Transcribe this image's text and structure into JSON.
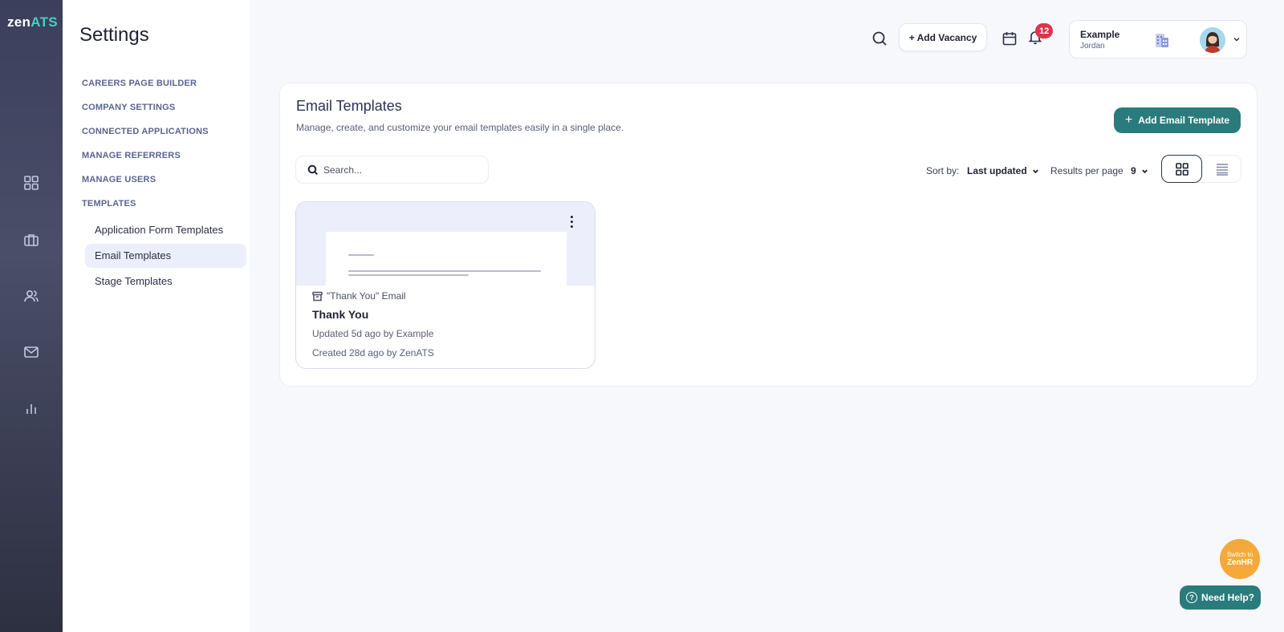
{
  "brand": {
    "logo_prefix": "zen",
    "logo_suffix": "ATS"
  },
  "rail": {
    "items": [
      {
        "icon": "dashboard-icon"
      },
      {
        "icon": "briefcase-icon"
      },
      {
        "icon": "users-icon"
      },
      {
        "icon": "mail-icon"
      },
      {
        "icon": "bar-chart-icon"
      }
    ]
  },
  "settings": {
    "title": "Settings",
    "sections": [
      {
        "label": "CAREERS PAGE BUILDER"
      },
      {
        "label": "COMPANY SETTINGS"
      },
      {
        "label": "CONNECTED APPLICATIONS"
      },
      {
        "label": "MANAGE REFERRERS"
      },
      {
        "label": "MANAGE USERS"
      },
      {
        "label": "TEMPLATES"
      }
    ],
    "template_links": [
      {
        "label": "Application Form Templates",
        "active": false
      },
      {
        "label": "Email Templates",
        "active": true
      },
      {
        "label": "Stage Templates",
        "active": false
      }
    ]
  },
  "topbar": {
    "add_vacancy_label": "+ Add Vacancy",
    "notification_count": "12",
    "account": {
      "company": "Example",
      "user": "Jordan"
    }
  },
  "main": {
    "title": "Email Templates",
    "subtitle": "Manage, create, and customize your email templates easily in a single place.",
    "add_button_label": "Add Email Template",
    "search_placeholder": "Search...",
    "sort_label": "Sort by:",
    "sort_value": "Last updated",
    "rpp_label": "Results per page",
    "rpp_value": "9",
    "view_mode": "grid"
  },
  "templates": [
    {
      "category": "\"Thank You\" Email",
      "name": "Thank You",
      "updated": "Updated 5d ago by Example",
      "created": "Created 28d ago by ZenATS"
    }
  ],
  "floating": {
    "switch_line1": "Switch to",
    "switch_line2": "ZenHR",
    "help_label": "Need Help?"
  },
  "colors": {
    "accent": "#2a7b7c",
    "badge": "#e0334a",
    "switch": "#f6a93b",
    "active_bg": "#eceefb"
  }
}
